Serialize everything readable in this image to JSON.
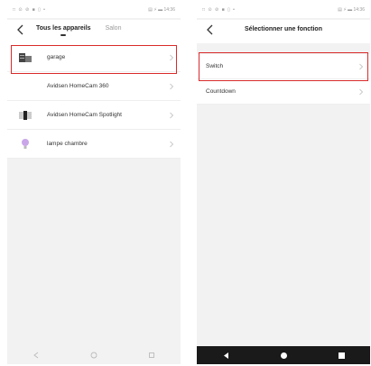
{
  "left": {
    "status_left": "□ ⊙ ⊘ ■ ▯ •",
    "status_right": "▤ ⚡ ▬ 14:36",
    "tabs": {
      "active": "Tous les appareils",
      "inactive": "Salon"
    },
    "devices": [
      {
        "label": "garage",
        "icon": "garage-door-icon"
      },
      {
        "label": "Avidsen HomeCam 360",
        "icon": "none"
      },
      {
        "label": "Avidsen HomeCam Spotlight",
        "icon": "spotlight-camera-icon"
      },
      {
        "label": "lampe chambre",
        "icon": "bulb-icon"
      }
    ]
  },
  "right": {
    "status_left": "□ ⊙ ⊘ ■ ▯ •",
    "status_right": "▤ ⚡ ▬ 14:36",
    "title": "Sélectionner une fonction",
    "functions": [
      {
        "label": "Switch"
      },
      {
        "label": "Countdown"
      }
    ]
  },
  "colors": {
    "highlight": "#d92b2b",
    "screen_bg": "#f2f2f2",
    "row_bg": "#ffffff"
  }
}
